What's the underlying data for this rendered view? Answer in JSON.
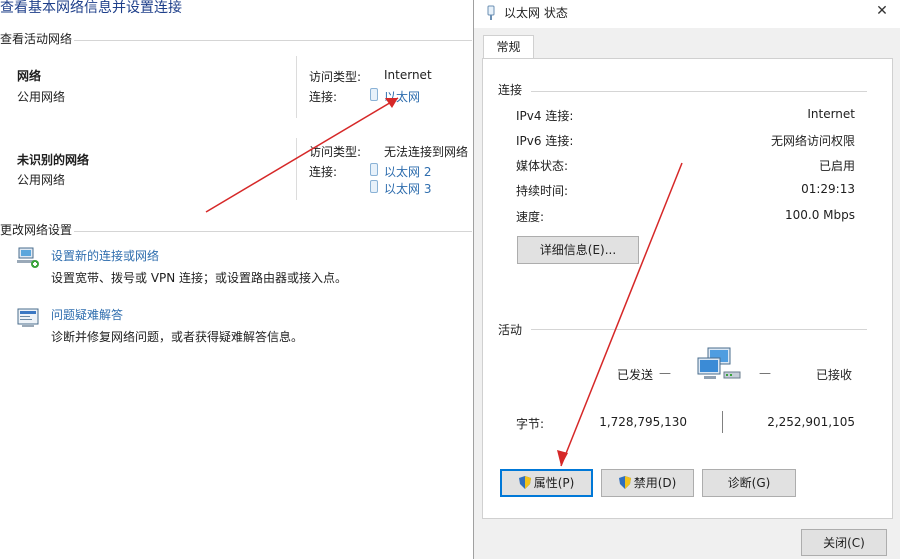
{
  "left_panel": {
    "title": "查看基本网络信息并设置连接",
    "active_section": "查看活动网络",
    "networks": [
      {
        "name": "网络",
        "type": "公用网络",
        "access_label": "访问类型:",
        "access_value": "Internet",
        "conn_label": "连接:",
        "connections": [
          "以太网"
        ]
      },
      {
        "name": "未识别的网络",
        "type": "公用网络",
        "access_label": "访问类型:",
        "access_value": "无法连接到网络",
        "conn_label": "连接:",
        "connections": [
          "以太网 2",
          "以太网 3"
        ]
      }
    ],
    "change_section": "更改网络设置",
    "actions": [
      {
        "icon": "network-setup-icon",
        "link": "设置新的连接或网络",
        "desc": "设置宽带、拨号或 VPN 连接；或设置路由器或接入点。"
      },
      {
        "icon": "troubleshoot-icon",
        "link": "问题疑难解答",
        "desc": "诊断并修复网络问题，或者获得疑难解答信息。"
      }
    ]
  },
  "dialog": {
    "title": "以太网 状态",
    "close_glyph": "✕",
    "tab": "常规",
    "connection_section": "连接",
    "rows": [
      {
        "label": "IPv4 连接:",
        "value": "Internet"
      },
      {
        "label": "IPv6 连接:",
        "value": "无网络访问权限"
      },
      {
        "label": "媒体状态:",
        "value": "已启用"
      },
      {
        "label": "持续时间:",
        "value": "01:29:13"
      },
      {
        "label": "速度:",
        "value": "100.0 Mbps"
      }
    ],
    "details_button": "详细信息(E)...",
    "activity_section": "活动",
    "sent_label": "已发送",
    "received_label": "已接收",
    "dash": "—",
    "bytes_label": "字节:",
    "bytes_sent": "1,728,795,130",
    "bytes_received": "2,252,901,105",
    "buttons": {
      "properties": "属性(P)",
      "disable": "禁用(D)",
      "diagnose": "诊断(G)",
      "close": "关闭(C)"
    }
  },
  "colors": {
    "link": "#2e6dae",
    "arrow": "#d62828",
    "focus": "#0078d7"
  }
}
